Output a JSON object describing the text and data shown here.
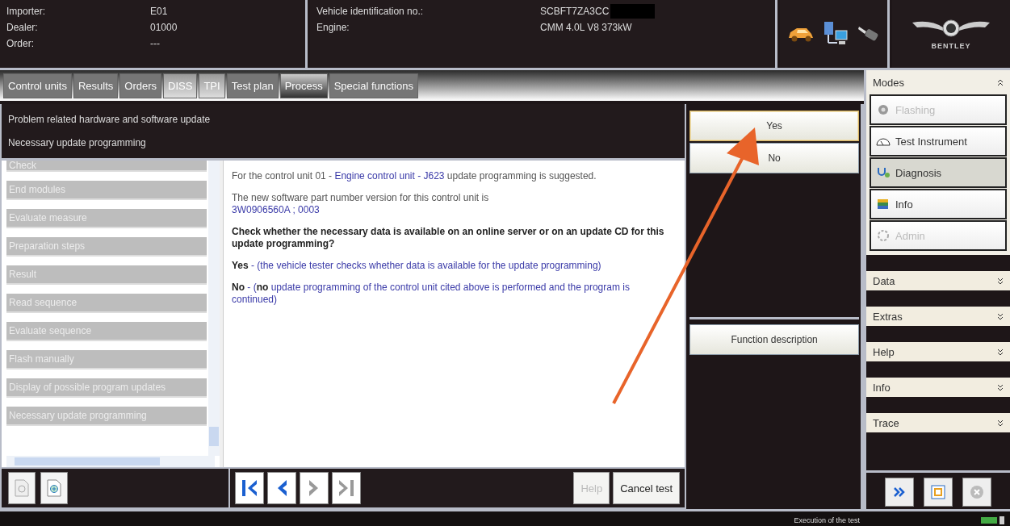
{
  "header": {
    "fields": [
      {
        "label": "Importer:",
        "value": "E01"
      },
      {
        "label": "Dealer:",
        "value": "01000"
      },
      {
        "label": "Order:",
        "value": "---"
      }
    ],
    "vehicle": [
      {
        "label": "Vehicle identification no.:",
        "value": "SCBFT7ZA3CC"
      },
      {
        "label": "Engine:",
        "value": "CMM 4.0L V8  373kW"
      }
    ],
    "vin_redacted": true,
    "brand": "BENTLEY"
  },
  "tabs": [
    {
      "label": "Control units",
      "selected": false,
      "disabled": true
    },
    {
      "label": "Results",
      "selected": false,
      "disabled": true
    },
    {
      "label": "Orders",
      "selected": false,
      "disabled": true
    },
    {
      "label": "DISS",
      "selected": false,
      "disabled": false
    },
    {
      "label": "TPI",
      "selected": false,
      "disabled": false
    },
    {
      "label": "Test plan",
      "selected": false,
      "disabled": true
    },
    {
      "label": "Process",
      "selected": true,
      "disabled": false
    },
    {
      "label": "Special functions",
      "selected": false,
      "disabled": true
    }
  ],
  "process": {
    "title": "Problem related hardware and software update",
    "subtitle": "Necessary update programming",
    "steps": [
      "Check",
      "End modules",
      "Evaluate measure",
      "Preparation steps",
      "Result",
      "Read sequence",
      "Evaluate sequence",
      "Flash manually",
      "Display of possible program updates",
      "Necessary update programming"
    ],
    "paragraphs": [
      [
        {
          "kind": "plain",
          "text": "For the control unit 01 - "
        },
        {
          "kind": "blue",
          "text": "Engine control unit - J623"
        },
        {
          "kind": "plain",
          "text": "   update programming is suggested."
        }
      ],
      [
        {
          "kind": "plain",
          "text": "The new software part number version for this control unit is"
        }
      ],
      [
        {
          "kind": "blue",
          "text": " 3W0906560A ; 0003"
        }
      ],
      [
        {
          "kind": "strong",
          "text": "Check whether the necessary data is available on an online server or on an update CD for this update programming?"
        }
      ],
      [
        {
          "kind": "strong",
          "text": "Yes"
        },
        {
          "kind": "blue",
          "text": " - (the vehicle tester checks whether data is available for the update programming)"
        }
      ],
      [
        {
          "kind": "strong",
          "text": "No"
        },
        {
          "kind": "blue",
          "text": " - ("
        },
        {
          "kind": "strong",
          "text": "no"
        },
        {
          "kind": "blue",
          "text": " update programming of the control unit cited above is performed and the program is continued)"
        }
      ]
    ]
  },
  "answers": [
    {
      "label": "Yes",
      "selected": true
    },
    {
      "label": "No",
      "selected": false
    }
  ],
  "function_description": "Function description",
  "nav": [
    {
      "kind": "first",
      "disabled": false
    },
    {
      "kind": "prev",
      "disabled": false
    },
    {
      "kind": "next",
      "disabled": true
    },
    {
      "kind": "last",
      "disabled": true
    }
  ],
  "help": {
    "label": "Help",
    "disabled": true
  },
  "cancel": "Cancel test",
  "modes": {
    "title": "Modes",
    "items": [
      {
        "label": "Flashing",
        "kind": "flash",
        "disabled": true,
        "selected": false
      },
      {
        "label": "Test Instrument",
        "kind": "gauge",
        "disabled": false,
        "selected": false
      },
      {
        "label": "Diagnosis",
        "kind": "stetho",
        "disabled": false,
        "selected": true
      },
      {
        "label": "Info",
        "kind": "books",
        "disabled": false,
        "selected": false
      },
      {
        "label": "Admin",
        "kind": "admin",
        "disabled": true,
        "selected": false
      }
    ]
  },
  "sections": [
    "Data",
    "Extras",
    "Help",
    "Info",
    "Trace"
  ],
  "status": "Execution of the test"
}
